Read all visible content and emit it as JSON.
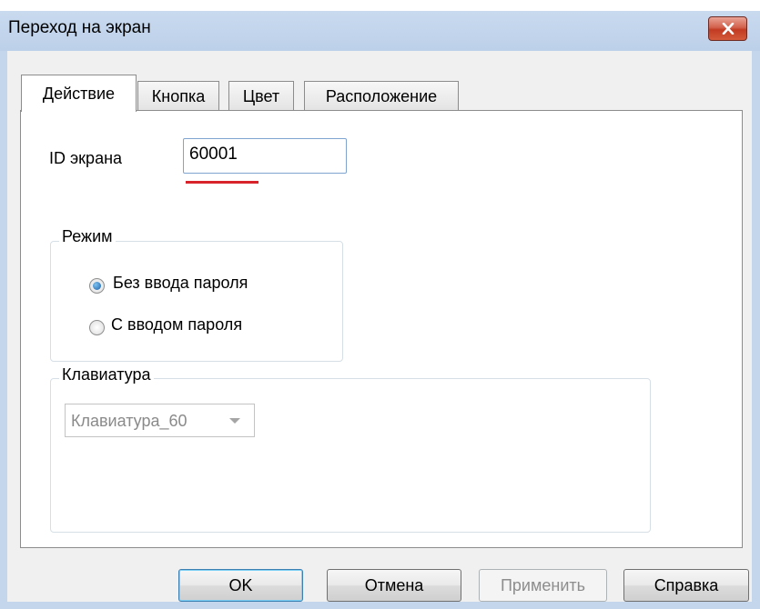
{
  "window": {
    "title": "Переход на экран",
    "close_icon": "close-icon"
  },
  "tabs": [
    {
      "label": "Действие",
      "active": true
    },
    {
      "label": "Кнопка",
      "active": false
    },
    {
      "label": "Цвет",
      "active": false
    },
    {
      "label": "Расположение",
      "active": false
    }
  ],
  "screen_id": {
    "label": "ID экрана",
    "value": "60001",
    "highlight_color": "#d9232a"
  },
  "mode": {
    "title": "Режим",
    "options": [
      {
        "label": "Без ввода пароля",
        "checked": true
      },
      {
        "label": "С вводом пароля",
        "checked": false
      }
    ]
  },
  "keyboard": {
    "title": "Клавиатура",
    "selected": "Клавиатура_60",
    "enabled": false
  },
  "buttons": {
    "ok": "OK",
    "cancel": "Отмена",
    "apply": "Применить",
    "help": "Справка"
  }
}
